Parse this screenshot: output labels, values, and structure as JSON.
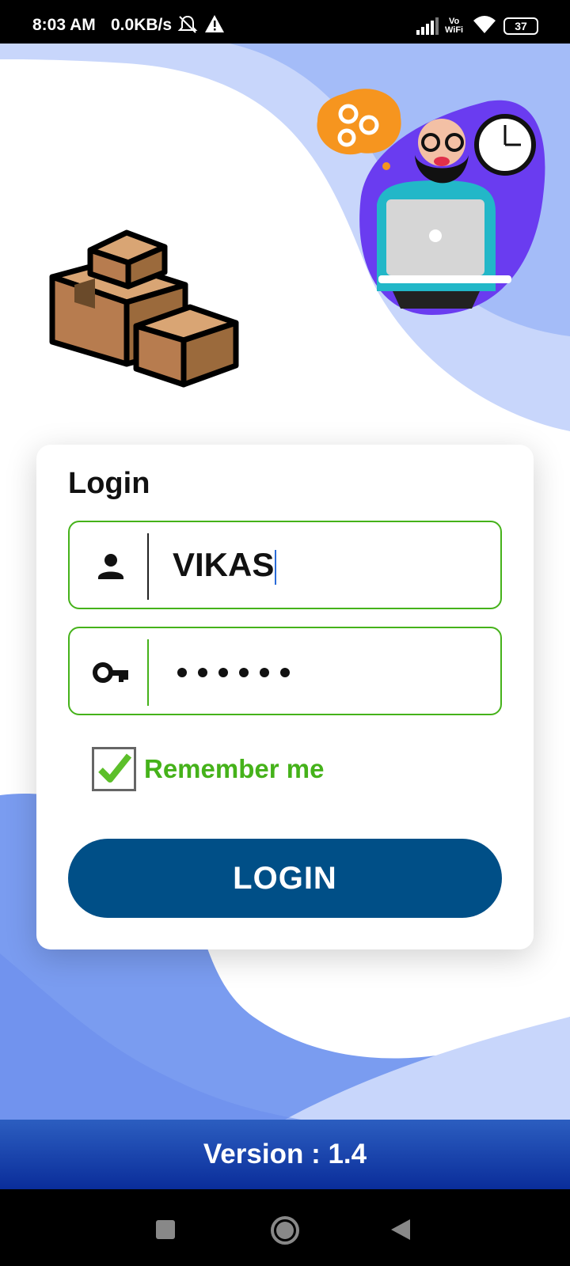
{
  "status_bar": {
    "time": "8:03 AM",
    "network_speed": "0.0KB/s",
    "icons": [
      "mute-bell-icon",
      "warning-icon",
      "signal-icon",
      "vowifi-icon",
      "wifi-icon",
      "battery-icon"
    ],
    "vowifi_top": "Vo",
    "vowifi_bottom": "WiFi",
    "battery_level": "37"
  },
  "login": {
    "title": "Login",
    "username_value": "VIKAS",
    "password_masked_length": 6,
    "remember_label": "Remember me",
    "remember_checked": true,
    "login_button": "LOGIN"
  },
  "footer": {
    "version": "Version : 1.4"
  },
  "navigation": [
    "recent-apps-icon",
    "home-icon",
    "back-icon"
  ],
  "colors": {
    "accent_green": "#45b21a",
    "button_blue": "#004f87",
    "version_bar_top": "#2c5ec0",
    "version_bar_bottom": "#0a2d9a",
    "wave_light": "#c8d6fb",
    "wave_mid": "#a4bcf8",
    "wave_deep": "#7a9cf0"
  }
}
